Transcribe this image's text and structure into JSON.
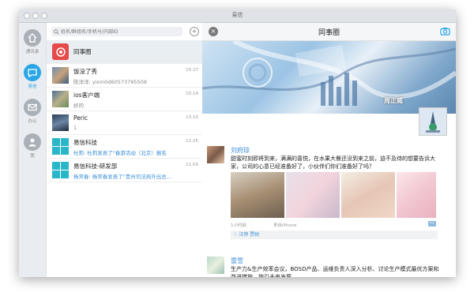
{
  "window": {
    "title": "易信"
  },
  "rail": {
    "items": [
      {
        "label": "通讯录",
        "icon": "home-icon"
      },
      {
        "label": "易信",
        "icon": "chat-icon"
      },
      {
        "label": "办公",
        "icon": "mail-icon"
      },
      {
        "label": "我",
        "icon": "person-icon"
      }
    ]
  },
  "search": {
    "placeholder": "姓名/群组名/手机号/内部ID"
  },
  "conversations": [
    {
      "name": "同事圈",
      "sub": "",
      "time": ""
    },
    {
      "name": "饭没了秀",
      "sub": "陈洋洋: yixin0d60573795509",
      "time": "15:27"
    },
    {
      "name": "ios客户端",
      "sub": "好的",
      "time": "15:14"
    },
    {
      "name": "Peric",
      "sub": "1",
      "time": "13:10"
    },
    {
      "name": "易信科技",
      "sub": "杜莉: 杜莉发表了\"春游活动（北京）报名",
      "time": "11:25"
    },
    {
      "name": "易信科技-研发部",
      "sub": "杨常春: 杨常春发表了\"贵州司法局外出总...",
      "time": "11:09"
    }
  ],
  "moments": {
    "title": "同事圈",
    "cover_name": "周正威",
    "posts": [
      {
        "author": "刘府琼",
        "text": "甜蜜时刻即将到来，满满的喜悦，在水果大餐还没到来之前，迫不及待的想要告诉大家，公司的心意已经准备好了，小伙伴们你们准备好了吗？",
        "time": "1小时前",
        "source": "来自iPhone",
        "likes": "♡ 汪萍  贾财"
      },
      {
        "author": "雷雪",
        "text": "生产力&生产效率会议，BOSD产品、运维负责人深入分析、讨论生产模式最优方案和改进措施，指引未来发展。",
        "time": "",
        "source": "",
        "likes": ""
      }
    ]
  },
  "colors": {
    "accent": "#2aa6e6",
    "link": "#3b8fd6"
  }
}
